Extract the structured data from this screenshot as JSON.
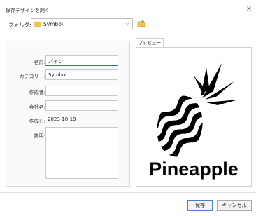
{
  "dialog": {
    "title": "保存デザインを開く",
    "close_glyph": "×"
  },
  "folder": {
    "label": "フォルダ:",
    "value": "Symbol",
    "icon": "folder-icon",
    "dropdown_icon": "chevron-down-icon",
    "browse_icon": "folder-browse-icon"
  },
  "form": {
    "name_label": "名前:",
    "name_value": "パイン",
    "category_label": "カテゴリー:",
    "category_value": "Symbol",
    "author_label": "作成者:",
    "author_value": "",
    "company_label": "会社名:",
    "company_value": "",
    "date_label": "作成日:",
    "date_value": "2023-10-19",
    "description_label": "説明:",
    "description_value": ""
  },
  "preview": {
    "tab_label": "プレビュー",
    "caption": "Pineapple",
    "image": "pineapple-symbol"
  },
  "buttons": {
    "save": "保存",
    "cancel": "キャンセル"
  }
}
